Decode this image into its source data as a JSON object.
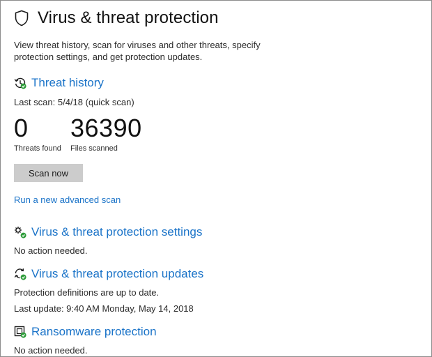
{
  "page": {
    "title": "Virus & threat protection",
    "description": "View threat history, scan for viruses and other threats, specify protection settings, and get protection updates."
  },
  "threat_history": {
    "title": "Threat history",
    "last_scan": "Last scan: 5/4/18 (quick scan)",
    "threats_found_value": "0",
    "threats_found_label": "Threats found",
    "files_scanned_value": "36390",
    "files_scanned_label": "Files scanned",
    "scan_button_label": "Scan now",
    "advanced_scan_link": "Run a new advanced scan"
  },
  "settings": {
    "title": "Virus & threat protection settings",
    "status": "No action needed."
  },
  "updates": {
    "title": "Virus & threat protection updates",
    "status": "Protection definitions are up to date.",
    "last_update": "Last update: 9:40 AM Monday, May 14, 2018"
  },
  "ransomware": {
    "title": "Ransomware protection",
    "status": "No action needed."
  },
  "icons": {
    "title": "shield-icon",
    "threat_history": "history-clock-icon",
    "settings": "gears-icon",
    "updates": "refresh-icon",
    "ransomware": "ransomware-folder-icon"
  },
  "colors": {
    "link": "#1a73c8",
    "ok_badge": "#2e9c3a",
    "button_bg": "#cccccc"
  }
}
